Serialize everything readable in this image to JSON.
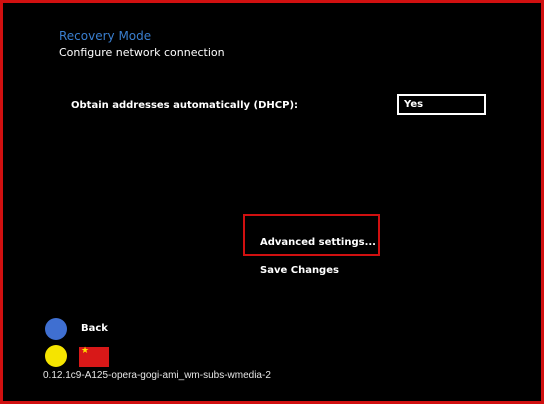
{
  "header": {
    "title": "Recovery Mode",
    "subtitle": "Configure network connection"
  },
  "dhcp": {
    "label": "Obtain addresses automatically (DHCP):",
    "value": "Yes"
  },
  "menu": {
    "advanced_label": "Advanced settings...",
    "save_label": "Save Changes"
  },
  "footer": {
    "back_label": "Back",
    "version": "0.12.1c9-A125-opera-gogi-ami_wm-subs-wmedia-2"
  },
  "icons": {
    "back_button": "blue-circle-icon",
    "yellow_button": "yellow-circle-icon",
    "flag": "china-flag-icon"
  },
  "colors": {
    "frame_border": "#d01010",
    "title": "#3a7fd0",
    "back_button": "#3f6fd1",
    "yellow_button": "#f5e400",
    "flag_red": "#d81818",
    "flag_star": "#ffde00"
  }
}
